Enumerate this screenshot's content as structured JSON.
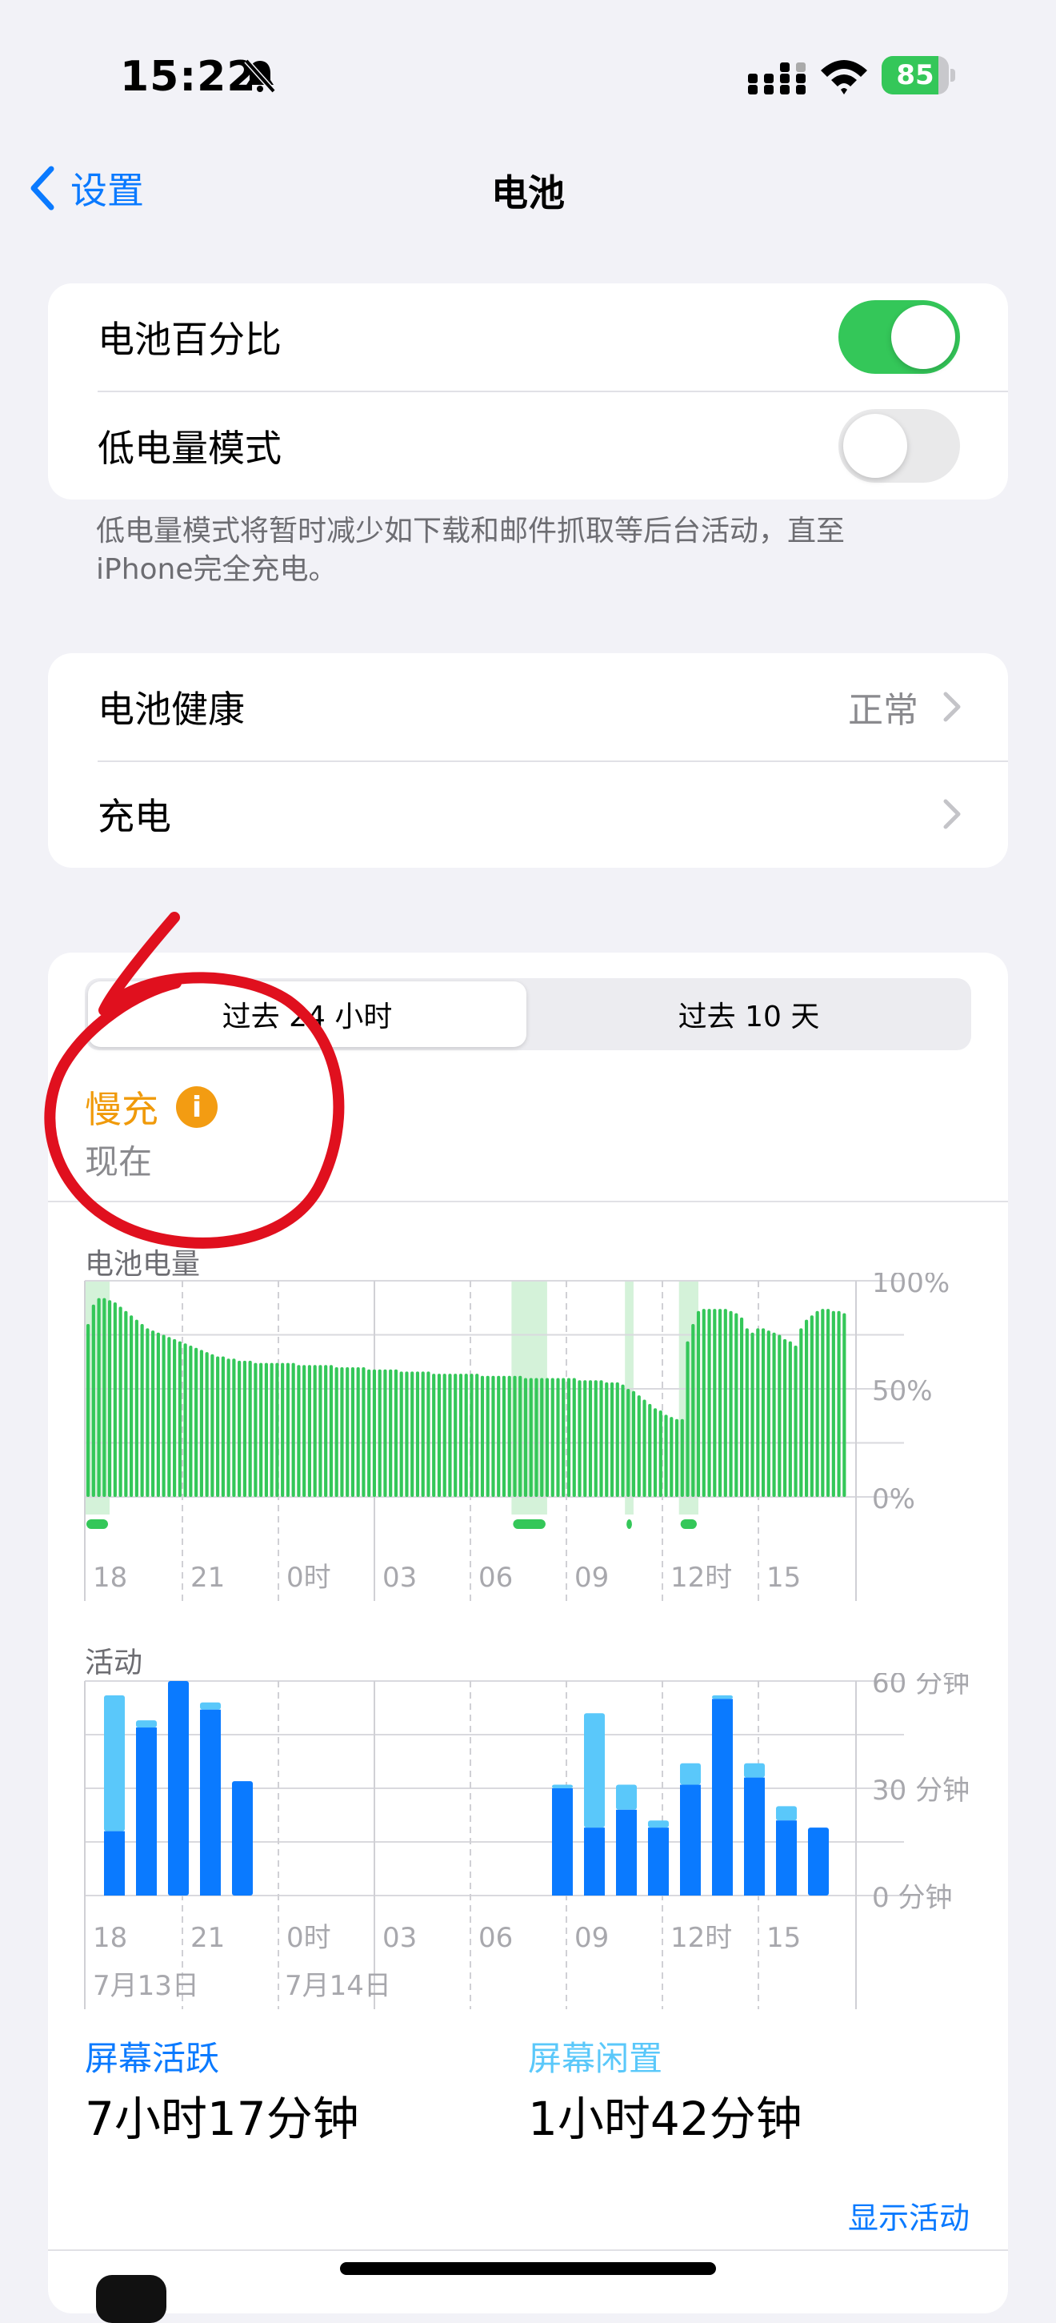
{
  "status_bar": {
    "time": "15:22",
    "battery": "85",
    "battery_level": 85
  },
  "nav": {
    "back_label": "设置",
    "title": "电池"
  },
  "section1": {
    "battery_percentage_label": "电池百分比",
    "battery_percentage_on": true,
    "low_power_label": "低电量模式",
    "low_power_on": false,
    "footnote": "低电量模式将暂时减少如下载和邮件抓取等后台活动，直至iPhone完全充电。"
  },
  "section2": {
    "health_label": "电池健康",
    "health_value": "正常",
    "charging_label": "充电"
  },
  "usage": {
    "tab_24h": "过去 24 小时",
    "tab_10d": "过去 10 天",
    "charge_status": "慢充",
    "charge_time": "现在",
    "info_symbol": "i",
    "screen_active_label": "屏幕活跃",
    "screen_active_value": "7小时17分钟",
    "screen_idle_label": "屏幕闲置",
    "screen_idle_value": "1小时42分钟",
    "show_activity": "显示活动"
  },
  "colors": {
    "accent": "#0a7aff",
    "green": "#34c759",
    "orange": "#f09a0a",
    "active_blue": "#0a7aff",
    "idle_blue": "#5ac8fa",
    "charge_band": "#d4f2d9",
    "annotation_red": "#e0101e"
  },
  "chart_data": [
    {
      "type": "bar",
      "title": "电池电量",
      "x_tick_labels": [
        "18",
        "21",
        "0时",
        "03",
        "06",
        "09",
        "12时",
        "15"
      ],
      "y_tick_labels": [
        "100%",
        "50%",
        "0%"
      ],
      "ylim": [
        0,
        100
      ],
      "unit": "%",
      "bar_count_estimate": "one bar per 15 minutes, 15 minutes each",
      "levels": [
        80,
        89,
        92,
        92,
        91,
        90,
        88,
        86,
        84,
        82,
        80,
        78,
        77,
        76,
        75,
        74,
        73,
        72,
        71,
        70,
        69,
        68,
        67,
        66,
        65,
        65,
        64,
        64,
        63,
        63,
        63,
        62,
        62,
        62,
        62,
        62,
        62,
        62,
        62,
        61,
        61,
        61,
        61,
        61,
        61,
        61,
        60,
        60,
        60,
        60,
        60,
        60,
        59,
        59,
        59,
        59,
        59,
        59,
        58,
        58,
        58,
        58,
        58,
        58,
        57,
        57,
        57,
        57,
        57,
        57,
        57,
        57,
        57,
        56,
        56,
        56,
        56,
        56,
        56,
        56,
        56,
        55,
        55,
        55,
        55,
        55,
        55,
        55,
        55,
        55,
        55,
        54,
        54,
        54,
        54,
        54,
        53,
        53,
        53,
        52,
        50,
        49,
        47,
        45,
        43,
        41,
        40,
        38,
        37,
        36,
        36,
        72,
        80,
        86,
        87,
        87,
        87,
        87,
        87,
        86,
        85,
        83,
        78,
        76,
        78,
        78,
        77,
        76,
        75,
        73,
        72,
        70,
        78,
        82,
        84,
        86,
        87,
        87,
        86,
        86,
        85
      ],
      "charging_periods": [
        [
          0,
          3
        ],
        [
          79,
          84
        ],
        [
          100,
          100
        ],
        [
          110,
          112
        ]
      ],
      "charging_note": "green shaded bands mark charging; dots under the axis mark charging markers"
    },
    {
      "type": "bar",
      "title": "活动",
      "stacked": true,
      "x_tick_labels": [
        "18",
        "21",
        "0时",
        "03",
        "06",
        "09",
        "12时",
        "15"
      ],
      "date_labels": [
        "7月13日",
        "7月14日"
      ],
      "y_tick_labels": [
        "60 分钟",
        "30 分钟",
        "0 分钟"
      ],
      "ylim": [
        0,
        60
      ],
      "unit": "分钟",
      "series": [
        {
          "name": "屏幕活跃",
          "values": [
            18,
            47,
            60,
            52,
            32,
            0,
            0,
            0,
            0,
            0,
            0,
            0,
            0,
            0,
            30,
            19,
            24,
            19,
            31,
            55,
            33,
            21,
            19
          ]
        },
        {
          "name": "屏幕闲置",
          "values": [
            38,
            2,
            0,
            2,
            0,
            0,
            0,
            0,
            0,
            0,
            0,
            0,
            0,
            0,
            1,
            32,
            7,
            2,
            6,
            1,
            4,
            4,
            0
          ]
        }
      ]
    }
  ]
}
